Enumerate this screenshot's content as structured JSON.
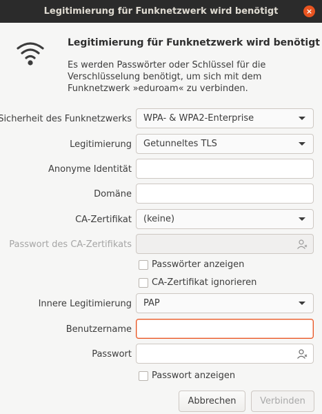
{
  "window": {
    "title": "Legitimierung für Funknetzwerk wird benötigt",
    "close_glyph": "×"
  },
  "header": {
    "icon": "wifi-icon",
    "title": "Legitimierung für Funknetzwerk wird benötigt",
    "description": "Es werden Passwörter oder Schlüssel für die Verschlüsselung benötigt, um sich mit dem Funknetzwerk »eduroam« zu verbinden."
  },
  "form": {
    "security_label": "Sicherheit des Funknetzwerks",
    "security_value": "WPA- & WPA2-Enterprise",
    "auth_label": "Legitimierung",
    "auth_value": "Getunneltes TLS",
    "anon_identity_label": "Anonyme Identität",
    "anon_identity_value": "",
    "domain_label": "Domäne",
    "domain_value": "",
    "ca_cert_label": "CA-Zertifikat",
    "ca_cert_value": "(keine)",
    "ca_password_label": "Passwort des CA-Zertifikats",
    "ca_password_value": "",
    "show_passwords_label": "Passwörter anzeigen",
    "ignore_ca_label": "CA-Zertifikat ignorieren",
    "inner_auth_label": "Innere Legitimierung",
    "inner_auth_value": "PAP",
    "username_label": "Benutzername",
    "username_value": "",
    "password_label": "Passwort",
    "password_value": "",
    "show_password_label": "Passwort anzeigen"
  },
  "buttons": {
    "cancel": "Abbrechen",
    "connect": "Verbinden"
  },
  "colors": {
    "accent": "#e95420",
    "titlebar": "#2b2b2b",
    "background": "#f6f6f5"
  }
}
